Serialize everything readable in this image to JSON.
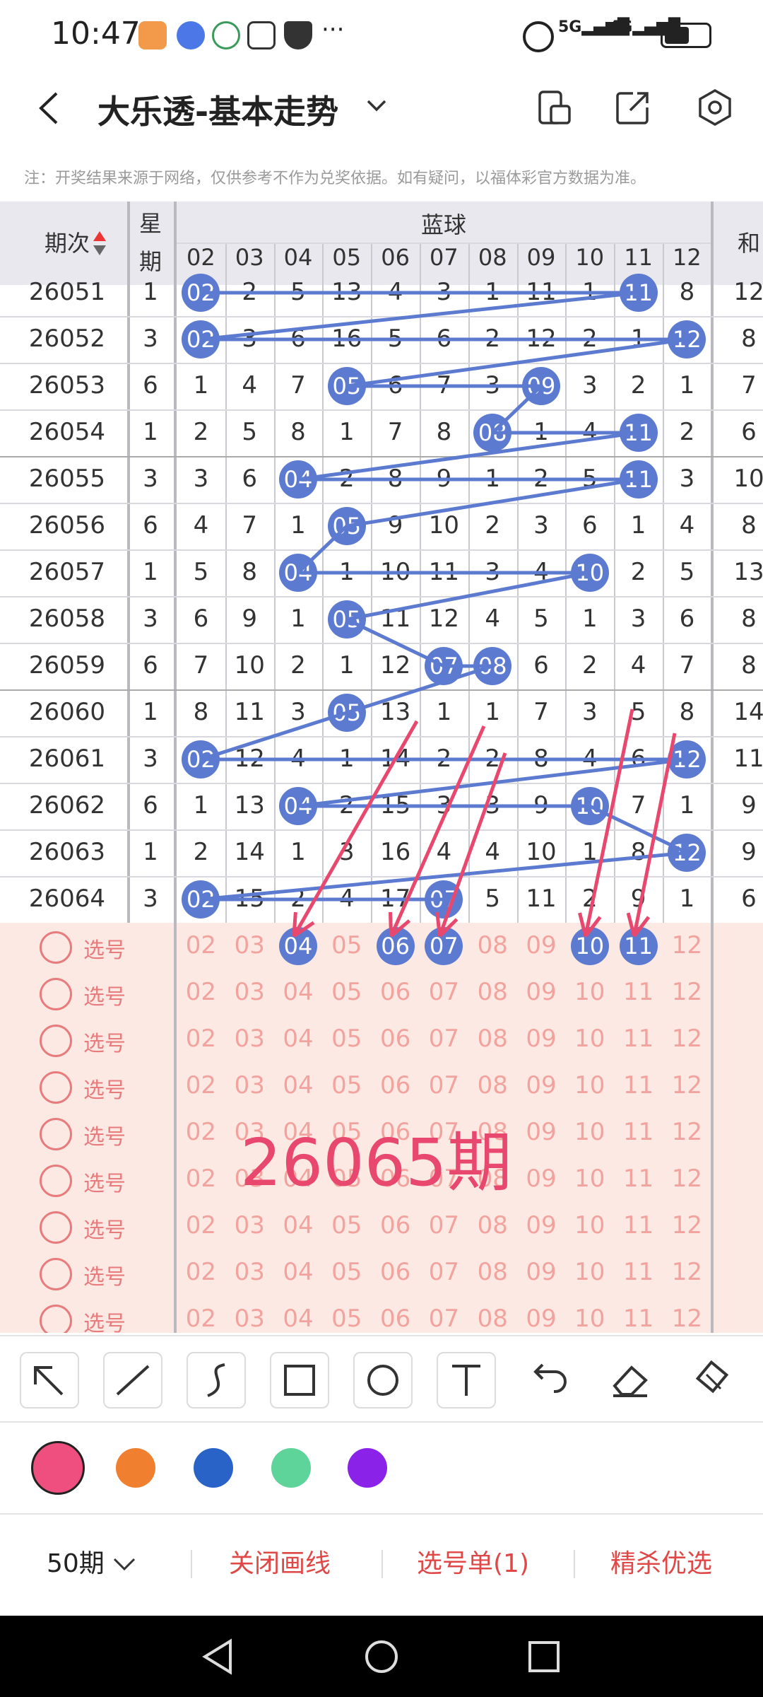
{
  "status_bar": {
    "time": "10:47",
    "signal_text": "5G 4G",
    "icons": [
      "notification-app-icon",
      "planet-icon",
      "money-icon",
      "hand-icon",
      "shield-icon",
      "more-icon",
      "alarm-icon",
      "signal-5g-icon",
      "signal-4g-icon",
      "battery-icon"
    ]
  },
  "header": {
    "title": "大乐透-基本走势",
    "back_icon": "chevron-left-icon",
    "dropdown_icon": "chevron-down-icon",
    "actions": [
      "phone-view-icon",
      "share-icon",
      "settings-icon"
    ]
  },
  "notice": "注：开奖结果来源于网络，仅供参考不作为兑奖依据。如有疑问，以福体彩官方数据为准。",
  "table": {
    "col_issue": "期次",
    "col_week_1": "星",
    "col_week_2": "期",
    "group_title": "蓝球",
    "col_sum": "和",
    "numbers": [
      "02",
      "03",
      "04",
      "05",
      "06",
      "07",
      "08",
      "09",
      "10",
      "11",
      "12"
    ],
    "rows": [
      {
        "issue": "26051",
        "week": "1",
        "cells": [
          "02",
          "2",
          "5",
          "13",
          "4",
          "3",
          "1",
          "11",
          "1",
          "11",
          "8"
        ],
        "hits": [
          0,
          9
        ],
        "sum": "12"
      },
      {
        "issue": "26052",
        "week": "3",
        "cells": [
          "02",
          "3",
          "6",
          "16",
          "5",
          "6",
          "2",
          "12",
          "2",
          "1",
          "12"
        ],
        "hits": [
          0,
          10
        ],
        "sum": "8"
      },
      {
        "issue": "26053",
        "week": "6",
        "cells": [
          "1",
          "4",
          "7",
          "05",
          "6",
          "7",
          "3",
          "09",
          "3",
          "2",
          "1"
        ],
        "hits": [
          3,
          7
        ],
        "sum": "7"
      },
      {
        "issue": "26054",
        "week": "1",
        "cells": [
          "2",
          "5",
          "8",
          "1",
          "7",
          "8",
          "08",
          "1",
          "4",
          "11",
          "2"
        ],
        "hits": [
          6,
          9
        ],
        "sum": "6"
      },
      {
        "issue": "26055",
        "week": "3",
        "cells": [
          "3",
          "6",
          "04",
          "2",
          "8",
          "9",
          "1",
          "2",
          "5",
          "11",
          "3"
        ],
        "hits": [
          2,
          9
        ],
        "sum": "10"
      },
      {
        "issue": "26056",
        "week": "6",
        "cells": [
          "4",
          "7",
          "1",
          "05",
          "9",
          "10",
          "2",
          "3",
          "6",
          "1",
          "4"
        ],
        "hits": [
          3
        ],
        "sum": "8"
      },
      {
        "issue": "26057",
        "week": "1",
        "cells": [
          "5",
          "8",
          "04",
          "1",
          "10",
          "11",
          "3",
          "4",
          "10",
          "2",
          "5"
        ],
        "hits": [
          2,
          8
        ],
        "sum": "13"
      },
      {
        "issue": "26058",
        "week": "3",
        "cells": [
          "6",
          "9",
          "1",
          "05",
          "11",
          "12",
          "4",
          "5",
          "1",
          "3",
          "6"
        ],
        "hits": [
          3
        ],
        "sum": "8"
      },
      {
        "issue": "26059",
        "week": "6",
        "cells": [
          "7",
          "10",
          "2",
          "1",
          "12",
          "07",
          "08",
          "6",
          "2",
          "4",
          "7"
        ],
        "hits": [
          5,
          6
        ],
        "sum": "8"
      },
      {
        "issue": "26060",
        "week": "1",
        "cells": [
          "8",
          "11",
          "3",
          "05",
          "13",
          "1",
          "1",
          "7",
          "3",
          "5",
          "8"
        ],
        "hits": [
          3
        ],
        "sum": "14"
      },
      {
        "issue": "26061",
        "week": "3",
        "cells": [
          "02",
          "12",
          "4",
          "1",
          "14",
          "2",
          "2",
          "8",
          "4",
          "6",
          "12"
        ],
        "hits": [
          0,
          10
        ],
        "sum": "11"
      },
      {
        "issue": "26062",
        "week": "6",
        "cells": [
          "1",
          "13",
          "04",
          "2",
          "15",
          "3",
          "3",
          "9",
          "10",
          "7",
          "1"
        ],
        "hits": [
          2,
          8
        ],
        "sum": "9"
      },
      {
        "issue": "26063",
        "week": "1",
        "cells": [
          "2",
          "14",
          "1",
          "3",
          "16",
          "4",
          "4",
          "10",
          "1",
          "8",
          "12"
        ],
        "hits": [
          10
        ],
        "sum": "9"
      },
      {
        "issue": "26064",
        "week": "3",
        "cells": [
          "02",
          "15",
          "2",
          "4",
          "17",
          "07",
          "5",
          "11",
          "2",
          "9",
          "1"
        ],
        "hits": [
          0,
          5
        ],
        "sum": "6"
      }
    ],
    "pick_label": "选号",
    "pick_rows": 9,
    "first_pick_selected": [
      2,
      4,
      5,
      8,
      9
    ],
    "annotation_text": "26065期"
  },
  "toolbar": {
    "tools": [
      "arrow-tool-icon",
      "line-tool-icon",
      "curve-tool-icon",
      "rectangle-tool-icon",
      "circle-tool-icon",
      "text-tool-icon",
      "undo-icon",
      "eraser-icon",
      "clear-icon"
    ],
    "colors": [
      "#ee4f7e",
      "#f08030",
      "#2a63c8",
      "#5fd49a",
      "#8a22e8"
    ],
    "selected_color": "#ee4f7e"
  },
  "bottom_bar": {
    "period_label": "50期",
    "close_draw": "关闭画线",
    "pick_list": "选号单(1)",
    "smart_pick": "精杀优选"
  }
}
